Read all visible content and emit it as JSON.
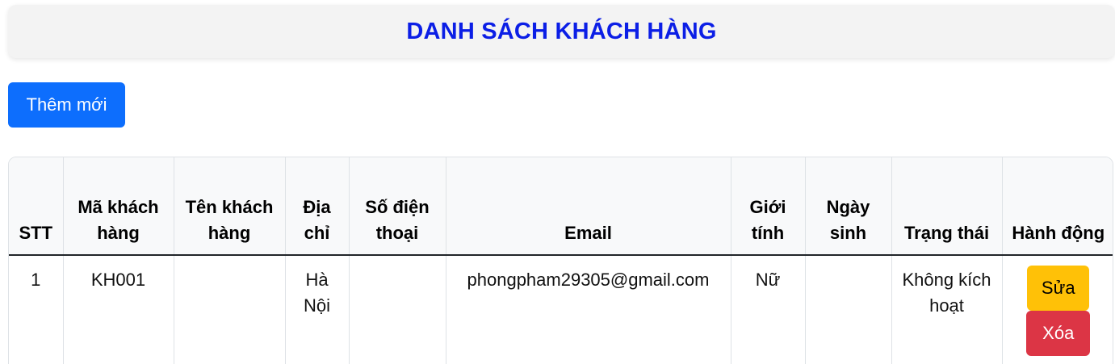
{
  "header": {
    "title": "DANH SÁCH KHÁCH HÀNG"
  },
  "toolbar": {
    "add_label": "Thêm mới"
  },
  "table": {
    "columns": [
      "STT",
      "Mã khách hàng",
      "Tên khách hàng",
      "Địa chỉ",
      "Số điện thoại",
      "Email",
      "Giới tính",
      "Ngày sinh",
      "Trạng thái",
      "Hành động"
    ],
    "rows": [
      {
        "stt": "1",
        "ma_khach_hang": "KH001",
        "ten_khach_hang": "",
        "dia_chi": "Hà Nội",
        "so_dien_thoai": "",
        "email": "phongpham29305@gmail.com",
        "gioi_tinh": "Nữ",
        "ngay_sinh": "",
        "trang_thai": "Không kích hoạt",
        "edit_label": "Sửa",
        "delete_label": "Xóa"
      }
    ]
  },
  "colors": {
    "title": "#0b1ee6",
    "primary": "#0d6efd",
    "warning": "#ffc107",
    "danger": "#dc3545"
  }
}
